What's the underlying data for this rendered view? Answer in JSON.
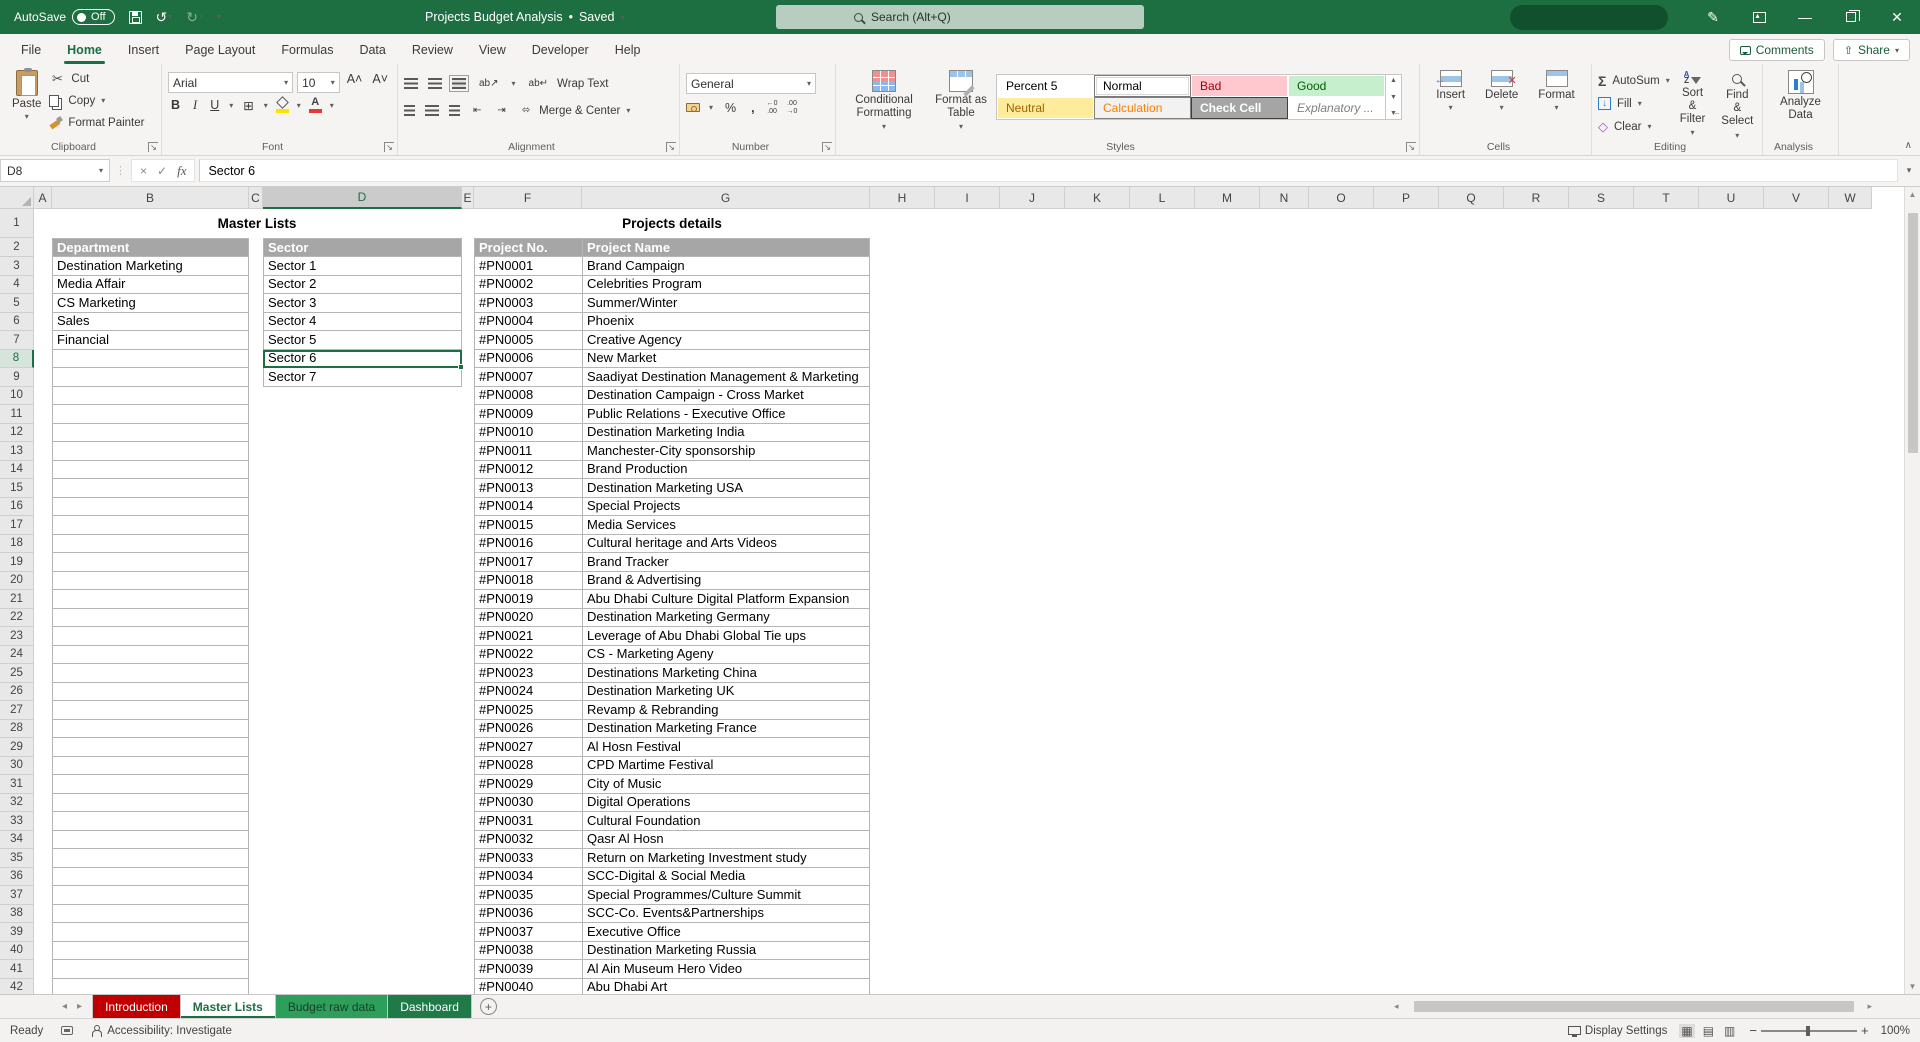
{
  "titlebar": {
    "autosave_label": "AutoSave",
    "autosave_state": "Off",
    "doc_title": "Projects Budget Analysis",
    "saved_label": "Saved",
    "search_placeholder": "Search (Alt+Q)"
  },
  "menu": {
    "tabs": [
      "File",
      "Home",
      "Insert",
      "Page Layout",
      "Formulas",
      "Data",
      "Review",
      "View",
      "Developer",
      "Help"
    ],
    "active_tab": "Home",
    "comments_label": "Comments",
    "share_label": "Share"
  },
  "ribbon": {
    "clipboard": {
      "label": "Clipboard",
      "paste": "Paste",
      "cut": "Cut",
      "copy": "Copy",
      "format_painter": "Format Painter"
    },
    "font": {
      "label": "Font",
      "font_name": "Arial",
      "font_size": "10",
      "bold": "B",
      "italic": "I",
      "underline": "U"
    },
    "alignment": {
      "label": "Alignment",
      "wrap_text": "Wrap Text",
      "merge_center": "Merge & Center"
    },
    "number": {
      "label": "Number",
      "format": "General"
    },
    "styles": {
      "label": "Styles",
      "conditional_formatting": "Conditional Formatting",
      "format_as_table": "Format as Table",
      "gallery": [
        {
          "label": "Percent 5",
          "bg": "#FFFFFF",
          "color": "#000000",
          "bold": false,
          "italic": false,
          "selected": false
        },
        {
          "label": "Normal",
          "bg": "#FFFFFF",
          "color": "#000000",
          "bold": false,
          "italic": false,
          "selected": true
        },
        {
          "label": "Bad",
          "bg": "#FFC7CE",
          "color": "#9C0006",
          "bold": false,
          "italic": false,
          "selected": false
        },
        {
          "label": "Good",
          "bg": "#C6EFCE",
          "color": "#006100",
          "bold": false,
          "italic": false,
          "selected": false
        },
        {
          "label": "Neutral",
          "bg": "#FFEB9C",
          "color": "#9C6500",
          "bold": false,
          "italic": false,
          "selected": false
        },
        {
          "label": "Calculation",
          "bg": "#F2F2F2",
          "color": "#FA7D00",
          "bold": false,
          "italic": false,
          "selected": false,
          "border": "#7F7F7F"
        },
        {
          "label": "Check Cell",
          "bg": "#A5A5A5",
          "color": "#FFFFFF",
          "bold": true,
          "italic": false,
          "selected": false,
          "border": "#3F3F3F"
        },
        {
          "label": "Explanatory ...",
          "bg": "#FFFFFF",
          "color": "#7F7F7F",
          "bold": false,
          "italic": true,
          "selected": false
        }
      ]
    },
    "cells": {
      "label": "Cells",
      "insert": "Insert",
      "delete": "Delete",
      "format": "Format"
    },
    "editing": {
      "label": "Editing",
      "autosum": "AutoSum",
      "fill": "Fill",
      "clear": "Clear",
      "sort_filter": "Sort & Filter",
      "find_select": "Find & Select"
    },
    "analysis": {
      "label": "Analysis",
      "analyze_data": "Analyze Data"
    }
  },
  "formula_bar": {
    "name_box": "D8",
    "content": "Sector 6",
    "fx": "fx"
  },
  "sheet": {
    "columns": [
      "A",
      "B",
      "C",
      "D",
      "E",
      "F",
      "G",
      "H",
      "I",
      "J",
      "K",
      "L",
      "M",
      "N",
      "O",
      "P",
      "Q",
      "R",
      "S",
      "T",
      "U",
      "V",
      "W"
    ],
    "selected_column": "D",
    "selected_row": 8,
    "selected_cell": "D8",
    "last_row": 42,
    "master_lists_title": "Master Lists",
    "projects_details_title": "Projects details",
    "department_header": "Department",
    "sector_header": "Sector",
    "project_no_header": "Project No.",
    "project_name_header": "Project Name",
    "departments": [
      "Destination Marketing",
      "Media Affair",
      "CS Marketing",
      "Sales",
      "Financial"
    ],
    "sectors": [
      "Sector 1",
      "Sector 2",
      "Sector 3",
      "Sector 4",
      "Sector 5",
      "Sector 6",
      "Sector 7"
    ],
    "projects": [
      {
        "no": "#PN0001",
        "name": "Brand Campaign"
      },
      {
        "no": "#PN0002",
        "name": "Celebrities Program"
      },
      {
        "no": "#PN0003",
        "name": "Summer/Winter"
      },
      {
        "no": "#PN0004",
        "name": "Phoenix"
      },
      {
        "no": "#PN0005",
        "name": "Creative Agency"
      },
      {
        "no": "#PN0006",
        "name": "New Market"
      },
      {
        "no": "#PN0007",
        "name": "Saadiyat Destination Management & Marketing"
      },
      {
        "no": "#PN0008",
        "name": "Destination Campaign - Cross Market"
      },
      {
        "no": "#PN0009",
        "name": "Public Relations - Executive Office"
      },
      {
        "no": "#PN0010",
        "name": "Destination Marketing India"
      },
      {
        "no": "#PN0011",
        "name": "Manchester-City sponsorship"
      },
      {
        "no": "#PN0012",
        "name": "Brand Production"
      },
      {
        "no": "#PN0013",
        "name": "Destination Marketing USA"
      },
      {
        "no": "#PN0014",
        "name": "Special Projects"
      },
      {
        "no": "#PN0015",
        "name": "Media Services"
      },
      {
        "no": "#PN0016",
        "name": "Cultural heritage and Arts Videos"
      },
      {
        "no": "#PN0017",
        "name": "Brand Tracker"
      },
      {
        "no": "#PN0018",
        "name": "Brand & Advertising"
      },
      {
        "no": "#PN0019",
        "name": "Abu Dhabi Culture Digital Platform Expansion"
      },
      {
        "no": "#PN0020",
        "name": "Destination Marketing Germany"
      },
      {
        "no": "#PN0021",
        "name": "Leverage of Abu Dhabi Global Tie ups"
      },
      {
        "no": "#PN0022",
        "name": "CS - Marketing Ageny"
      },
      {
        "no": "#PN0023",
        "name": "Destinations Marketing China"
      },
      {
        "no": "#PN0024",
        "name": "Destination Marketing UK"
      },
      {
        "no": "#PN0025",
        "name": "Revamp & Rebranding"
      },
      {
        "no": "#PN0026",
        "name": "Destination Marketing France"
      },
      {
        "no": "#PN0027",
        "name": "Al Hosn Festival"
      },
      {
        "no": "#PN0028",
        "name": "CPD Martime Festival"
      },
      {
        "no": "#PN0029",
        "name": "City of Music"
      },
      {
        "no": "#PN0030",
        "name": "Digital Operations"
      },
      {
        "no": "#PN0031",
        "name": "Cultural Foundation"
      },
      {
        "no": "#PN0032",
        "name": "Qasr Al Hosn"
      },
      {
        "no": "#PN0033",
        "name": "Return on Marketing Investment study"
      },
      {
        "no": "#PN0034",
        "name": "SCC-Digital & Social Media"
      },
      {
        "no": "#PN0035",
        "name": "Special Programmes/Culture Summit"
      },
      {
        "no": "#PN0036",
        "name": "SCC-Co. Events&Partnerships"
      },
      {
        "no": "#PN0037",
        "name": "Executive Office"
      },
      {
        "no": "#PN0038",
        "name": "Destination Marketing Russia"
      },
      {
        "no": "#PN0039",
        "name": "Al Ain Museum Hero Video"
      },
      {
        "no": "#PN0040",
        "name": "Abu Dhabi Art"
      }
    ]
  },
  "sheet_tabs": [
    {
      "label": "Introduction",
      "bg": "#C00000",
      "color": "#FFFFFF",
      "active": false
    },
    {
      "label": "Master Lists",
      "bg": "#FFFFFF",
      "color": "#1d6f42",
      "active": true
    },
    {
      "label": "Budget raw data",
      "bg": "#2E9E5B",
      "color": "#17402A",
      "active": false
    },
    {
      "label": "Dashboard",
      "bg": "#1F7A47",
      "color": "#FFFFFF",
      "active": false
    }
  ],
  "status_bar": {
    "ready": "Ready",
    "accessibility": "Accessibility: Investigate",
    "display_settings": "Display Settings",
    "zoom_level": "100%"
  }
}
